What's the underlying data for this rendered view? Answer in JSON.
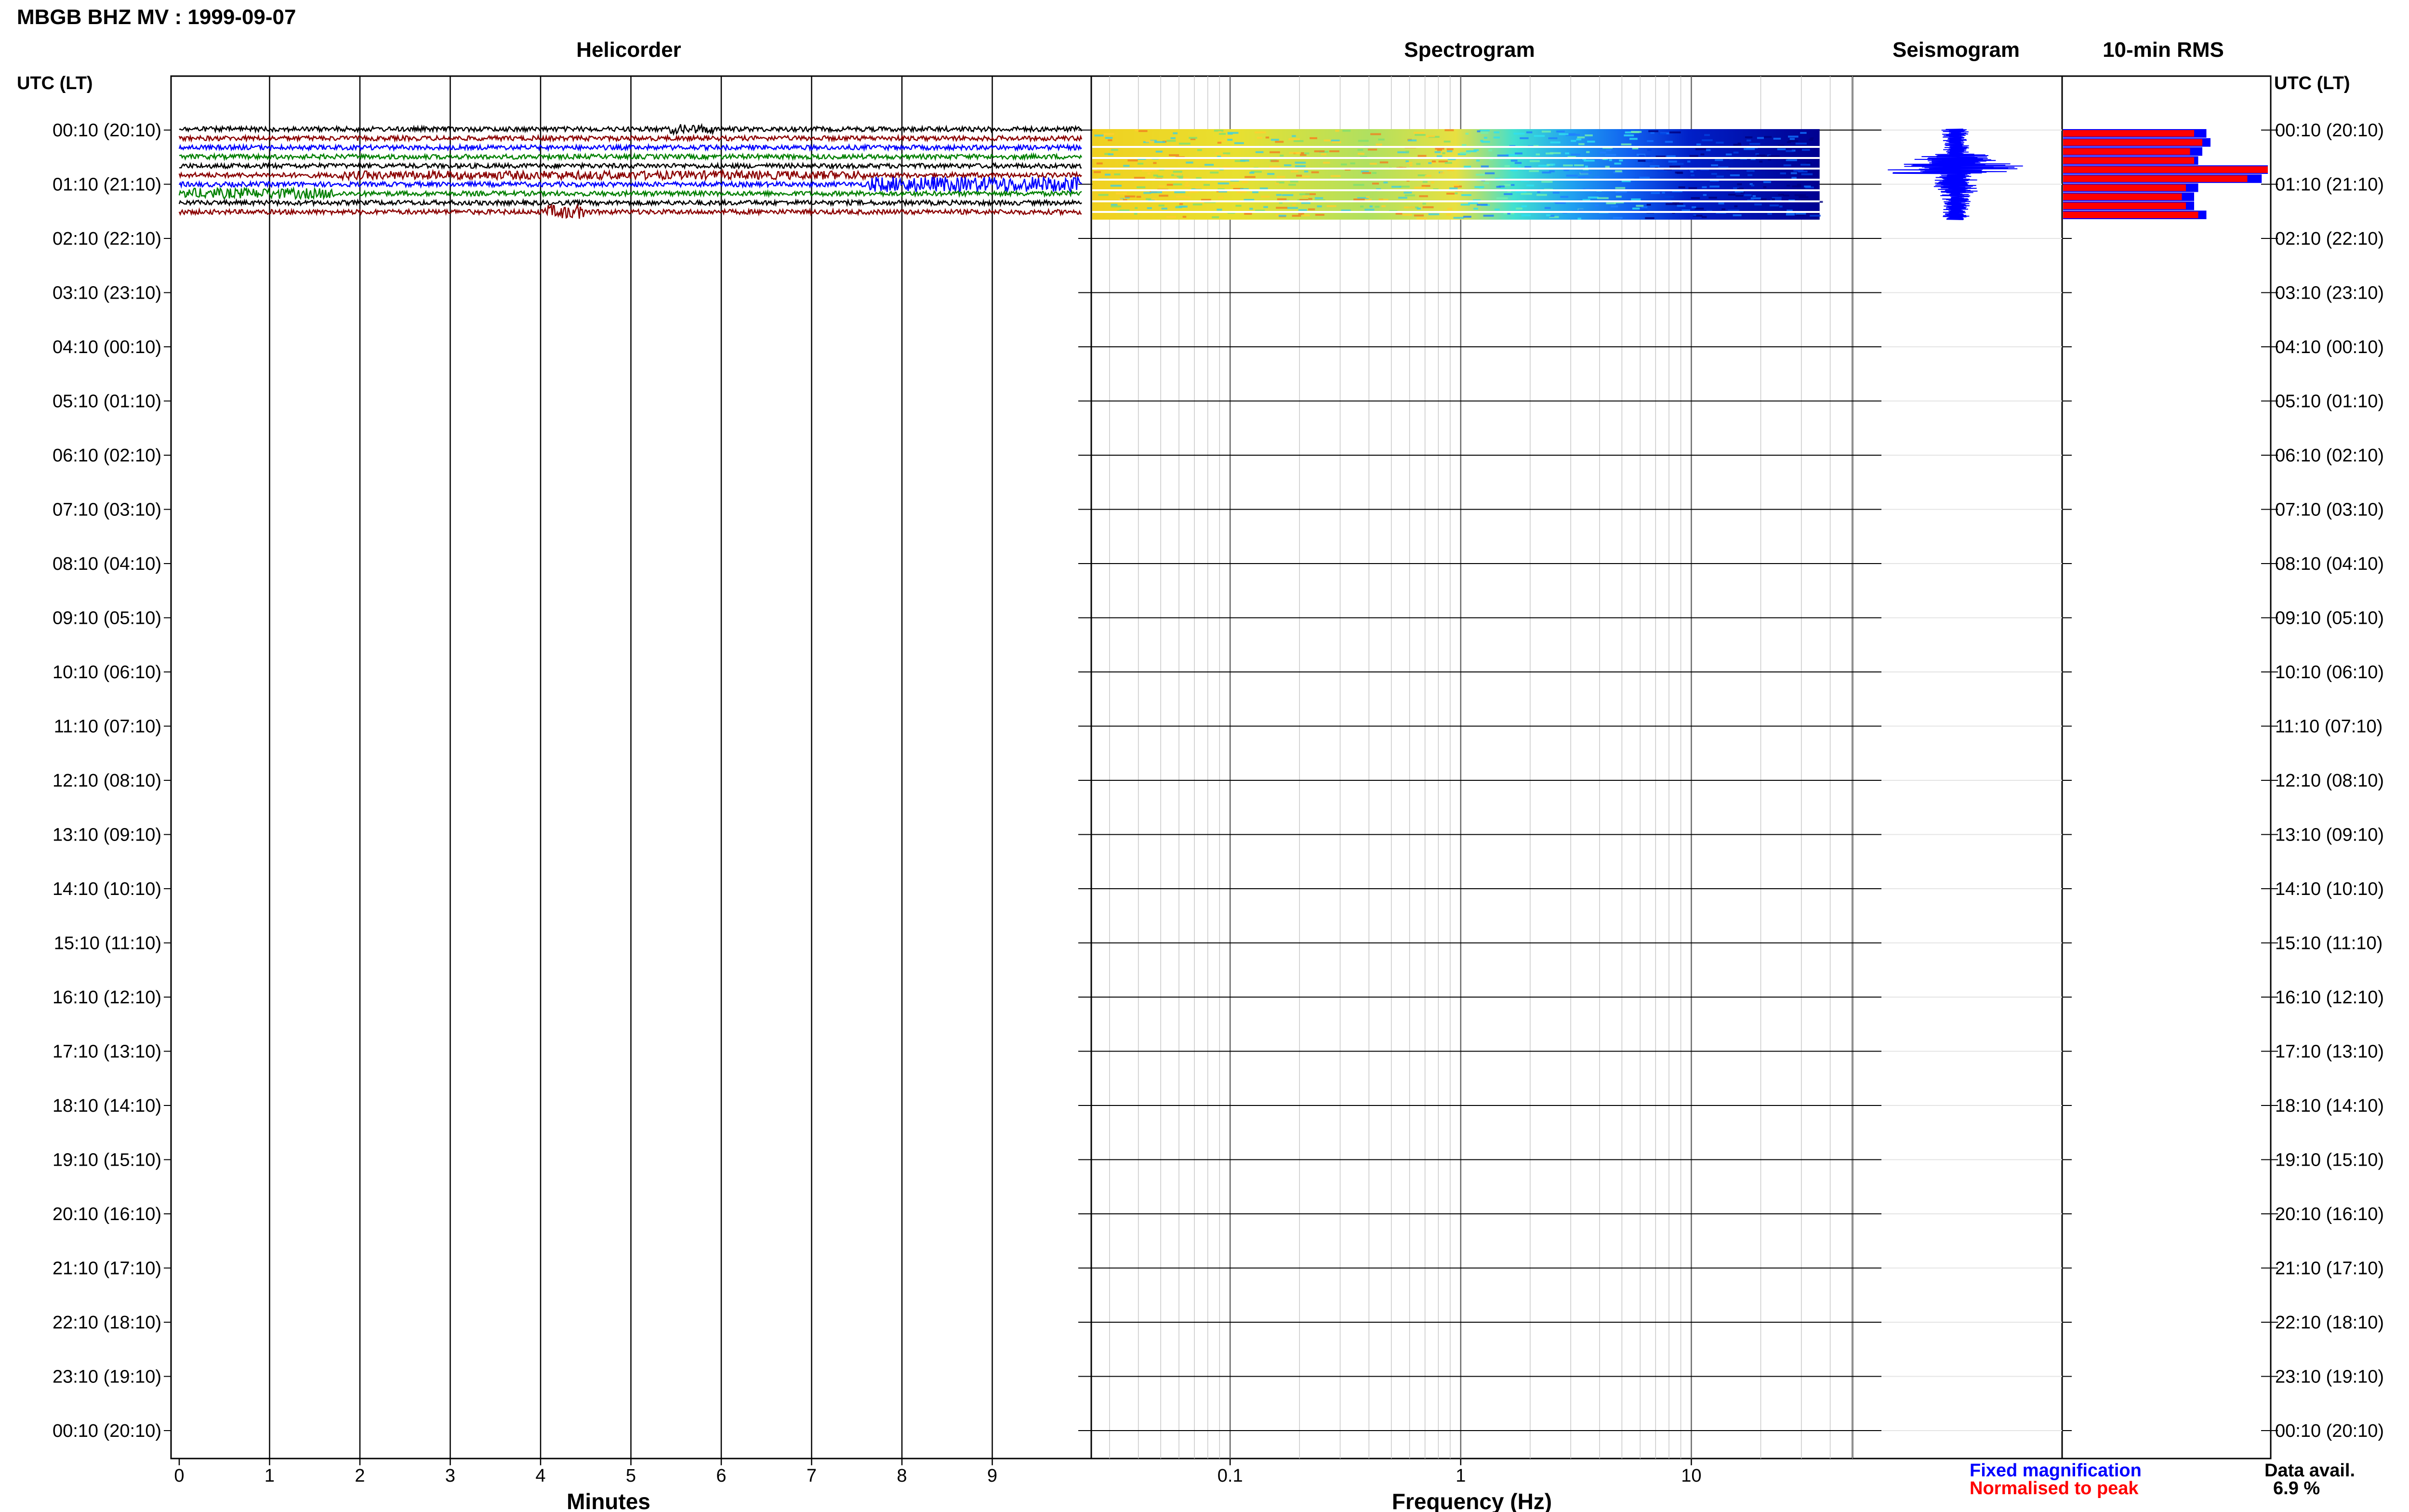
{
  "header": {
    "title": "MBGB BHZ MV : 1999-09-07"
  },
  "axis_left_label": "UTC (LT)",
  "axis_right_label": "UTC (LT)",
  "panels": {
    "helicorder": "Helicorder",
    "spectrogram": "Spectrogram",
    "seismogram": "Seismogram",
    "rms": "10-min RMS"
  },
  "row_labels": [
    "00:10 (20:10)",
    "01:10 (21:10)",
    "02:10 (22:10)",
    "03:10 (23:10)",
    "04:10 (00:10)",
    "05:10 (01:10)",
    "06:10 (02:10)",
    "07:10 (03:10)",
    "08:10 (04:10)",
    "09:10 (05:10)",
    "10:10 (06:10)",
    "11:10 (07:10)",
    "12:10 (08:10)",
    "13:10 (09:10)",
    "14:10 (10:10)",
    "15:10 (11:10)",
    "16:10 (12:10)",
    "17:10 (13:10)",
    "18:10 (14:10)",
    "19:10 (15:10)",
    "20:10 (16:10)",
    "21:10 (17:10)",
    "22:10 (18:10)",
    "23:10 (19:10)",
    "00:10 (20:10)"
  ],
  "legend": {
    "fixed": "Fixed magnification",
    "normalised": "Normalised to peak",
    "data_avail_label": "Data avail.",
    "data_avail_value": "6.9 %"
  },
  "colors": {
    "fixed": "#0000ff",
    "normalised": "#ff0000",
    "trace_cycle": [
      "#000000",
      "#8b0000",
      "#0000ff",
      "#008000"
    ]
  },
  "chart_data": [
    {
      "type": "line",
      "title": "Helicorder",
      "xlabel": "Minutes",
      "x_ticks": [
        "0",
        "1",
        "2",
        "3",
        "4",
        "5",
        "6",
        "7",
        "8",
        "9"
      ],
      "xlim": [
        0,
        10
      ],
      "rows_with_data": 10,
      "traces_per_row": 6
    },
    {
      "type": "heatmap",
      "title": "Spectrogram",
      "xlabel": "Frequency (Hz)",
      "x_scale": "log",
      "x_ticks": [
        "0.1",
        "1",
        "10"
      ],
      "xlim": [
        0.025,
        50
      ],
      "data_rows": 10,
      "colormap": "jet"
    },
    {
      "type": "line",
      "title": "Seismogram",
      "color": "#0000ff"
    },
    {
      "type": "bar",
      "title": "10-min RMS",
      "orientation": "horizontal",
      "series": [
        {
          "name": "Fixed magnification",
          "values": [
            0.7,
            0.72,
            0.68,
            0.66,
            1.0,
            0.97,
            0.66,
            0.64,
            0.64,
            0.7
          ]
        },
        {
          "name": "Normalised to peak",
          "values": [
            0.64,
            0.68,
            0.62,
            0.64,
            1.0,
            0.9,
            0.6,
            0.58,
            0.6,
            0.66
          ]
        }
      ]
    }
  ]
}
